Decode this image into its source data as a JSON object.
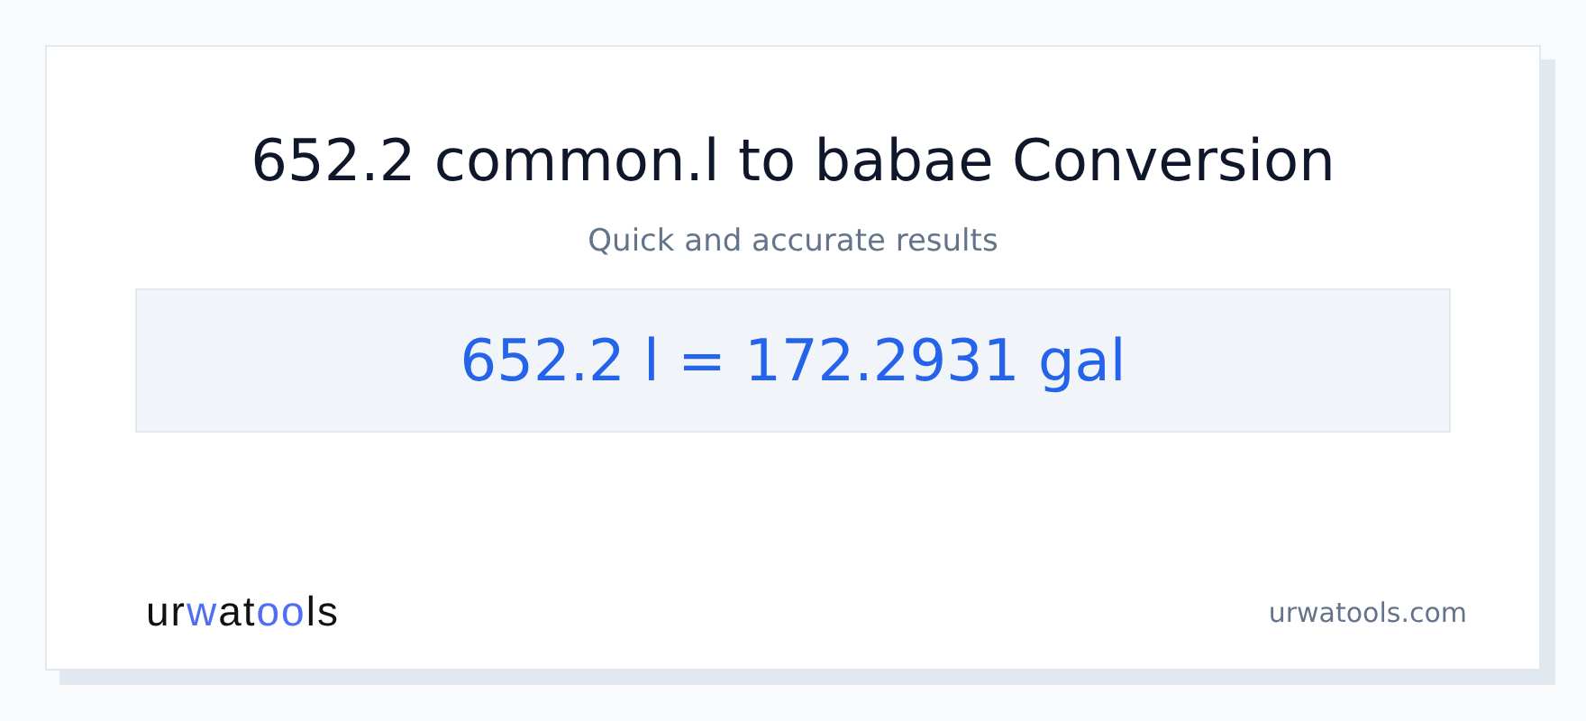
{
  "title": "652.2 common.l to babae Conversion",
  "subtitle": "Quick and accurate results",
  "result": "652.2 l = 172.2931 gal",
  "logo": [
    {
      "text": "ur",
      "accent": false
    },
    {
      "text": "w",
      "accent": true
    },
    {
      "text": "at",
      "accent": false
    },
    {
      "text": "oo",
      "accent": true
    },
    {
      "text": "ls",
      "accent": false
    }
  ],
  "site": "urwatools.com"
}
